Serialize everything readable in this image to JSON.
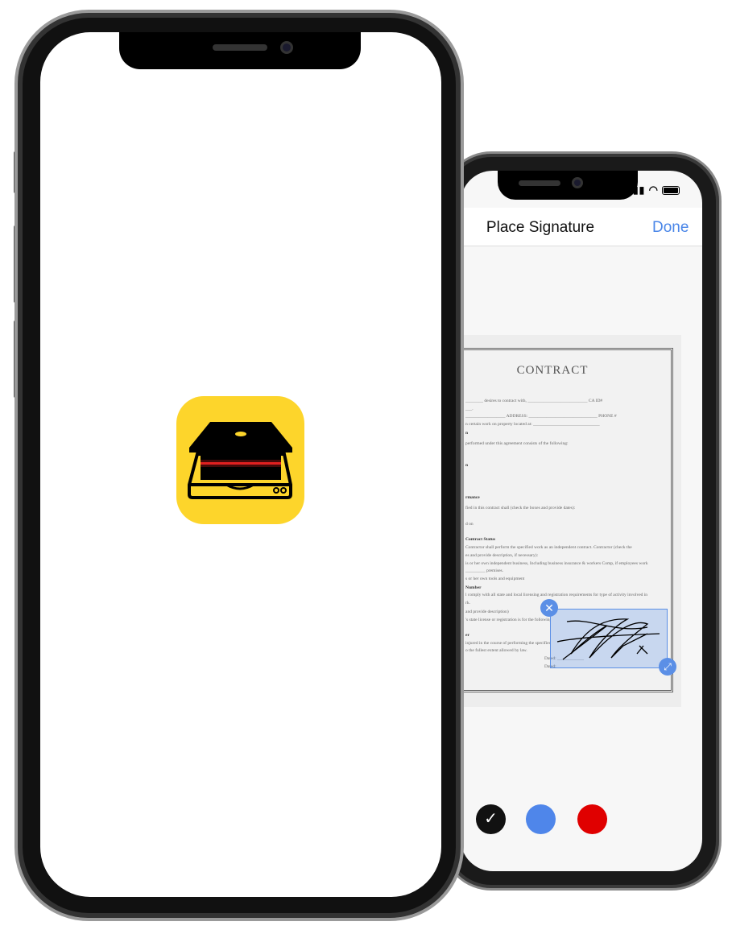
{
  "back_phone": {
    "nav": {
      "title": "Place Signature",
      "done_label": "Done"
    },
    "status_icons": [
      "signal-icon",
      "wifi-icon",
      "battery-icon"
    ],
    "document": {
      "title": "CONTRACT",
      "lines": [
        "________ desires to contract with, ___________________________ CA ID#",
        "___.",
        "__________________ ADDRESS: _______________________________ PHONE #",
        "n certain work on property located at: ______________________________",
        "n",
        "performed under this agreement consists of the following:",
        "n",
        "rmance",
        "fied in this contract shall (check the boxes and provide dates):",
        "d on",
        "Contract Status",
        "Contractor shall perform the specified work as an independent contract.  Contractor (check the",
        "es and provide description, if necessary):",
        "is or her own independent business, Including business insurance & workers Comp, if employees work",
        "_________ premises.",
        "s or her own tools and equipment",
        "Number",
        "l comply with all state and local licensing and registration requirements for type of activity involved in",
        "rk.",
        "and provide description)",
        "'s state license or registration is for the following type of work and carries the following",
        "er",
        "injured in the course of performing the specified work, Business Owner shall be ...",
        "o the fullest extent allowed by law.",
        "Dated: ____________",
        "Dated: ____________"
      ]
    },
    "signature_colors": [
      {
        "name": "black",
        "hex": "#111111",
        "selected": true
      },
      {
        "name": "blue",
        "hex": "#4f86ea",
        "selected": false
      },
      {
        "name": "red",
        "hex": "#e00000",
        "selected": false
      }
    ],
    "accent": "#4a86e8"
  },
  "front_phone": {
    "app_icon": {
      "name": "scanner-app-icon",
      "background": "#fdd52b"
    }
  }
}
